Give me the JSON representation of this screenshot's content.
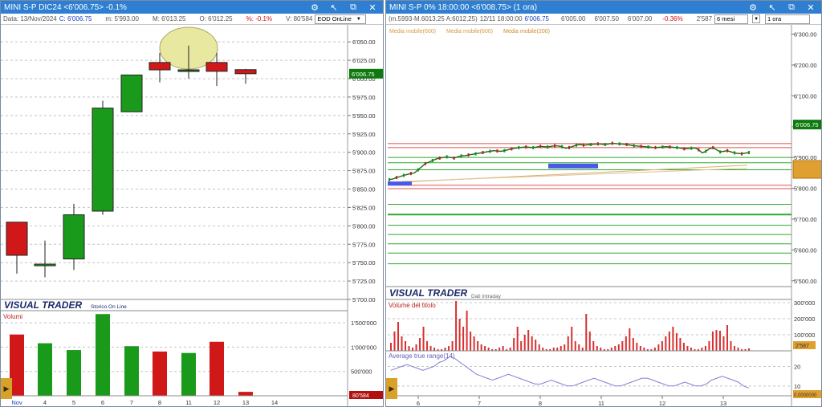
{
  "left_window": {
    "title": "MINI S-P DIC24 <6'006.75> -0.1%",
    "info": {
      "date": "Data: 13/Nov/2024",
      "close": "C: 6'006.75",
      "min": "m: 5'993.00",
      "max": "M: 6'013.25",
      "open": "O: 6'012.25",
      "pct": "%: -0.1%",
      "vol": "V: 80'584",
      "mode_select": "EOD OnLine"
    },
    "price_axis": [
      "6'050.00",
      "6'025.00",
      "6'000.00",
      "5'975.00",
      "5'950.00",
      "5'925.00",
      "5'900.00",
      "5'875.00",
      "5'850.00",
      "5'825.00",
      "5'800.00",
      "5'775.00",
      "5'750.00",
      "5'725.00",
      "5'700.00"
    ],
    "last_price_label": "6'006.75",
    "brand": "VISUAL TRADER",
    "brand_sub": "Storico On Line",
    "volume_title": "Volumi",
    "volume_axis": [
      "1'500'000",
      "1'000'000",
      "500'000"
    ],
    "last_volume_label": "80'584",
    "x_labels": [
      "Nov",
      "4",
      "5",
      "6",
      "7",
      "8",
      "11",
      "12",
      "13",
      "14"
    ],
    "colors": {
      "up": "#1a9a1a",
      "down": "#d01818",
      "highlight": "#e8e8a0"
    }
  },
  "right_window": {
    "title": "MINI S-P 0% 18:00:00 <6'008.75> (1 ora)",
    "info": {
      "range": "(m.5993-M.6013,25 A:6012,25)",
      "datetime": "12/11 18:00:00",
      "last": "6'006.75",
      "v1": "6'005.00",
      "v2": "6'007.50",
      "v3": "6'007.00",
      "pct": "-0.36%",
      "vol": "2'587",
      "period_select": "6 mesi",
      "interval_select": "1 ora"
    },
    "moving_averages": [
      "Media mobile(600)",
      "Media mobile(600)",
      "Media mobile(200)"
    ],
    "price_axis": [
      "6'300.00",
      "6'200.00",
      "6'100.00",
      "6'000.00",
      "5'900.00",
      "5'800.00",
      "5'700.00",
      "5'600.00",
      "5'500.00"
    ],
    "last_price_label": "6'006.75",
    "brand": "VISUAL TRADER",
    "brand_sub": "Dati Intraday",
    "volume_title": "Volume del titolo",
    "volume_axis": [
      "300'000",
      "200'000",
      "100'000"
    ],
    "last_volume_label": "2'587",
    "atr_title": "Average true range(14)",
    "atr_axis": [
      "20",
      "10"
    ],
    "last_atr_label": "0.0000000",
    "x_labels": [
      "6",
      "7",
      "8",
      "11",
      "12",
      "13"
    ]
  },
  "chart_data": [
    {
      "type": "candlestick",
      "title": "MINI S-P DIC24",
      "categories": [
        "Nov 1",
        "Nov 4",
        "Nov 5",
        "Nov 6",
        "Nov 7",
        "Nov 8",
        "Nov 11",
        "Nov 12",
        "Nov 13"
      ],
      "open": [
        5805,
        5748,
        5755,
        5820,
        5955,
        6022,
        6012,
        6022,
        6012.25
      ],
      "high": [
        5805,
        5780,
        5830,
        5970,
        6005,
        6035,
        6045,
        6035,
        6013.25
      ],
      "low": [
        5735,
        5730,
        5740,
        5815,
        5955,
        5995,
        6000,
        5990,
        5993
      ],
      "close": [
        5760,
        5748,
        5815,
        5960,
        6005,
        6012,
        6012,
        6010,
        6006.75
      ],
      "volume": [
        1260000,
        1080000,
        940000,
        1680000,
        1020000,
        910000,
        880000,
        1110000,
        80584
      ],
      "ylim": [
        5700,
        6060
      ]
    },
    {
      "type": "line",
      "title": "MINI S-P 1 ora",
      "ylim": [
        5450,
        6330
      ],
      "x_labels": [
        "6",
        "7",
        "8",
        "11",
        "12",
        "13"
      ],
      "series": [
        {
          "values": [
            5828,
            5830,
            5835,
            5838,
            5842,
            5845,
            5848,
            5850,
            5860,
            5870,
            5880,
            5885,
            5890,
            5895,
            5898,
            5900,
            5902,
            5900,
            5898,
            5902,
            5905,
            5906,
            5908,
            5910,
            5912,
            5914,
            5916,
            5918,
            5920,
            5922,
            5921,
            5920,
            5922,
            5925,
            5928,
            5930,
            5932,
            5933,
            5934,
            5933,
            5932,
            5934,
            5936,
            5935,
            5934,
            5936,
            5938,
            5937,
            5935,
            5930,
            5932,
            5936,
            5940,
            5942,
            5940,
            5941,
            5942,
            5943,
            5944,
            5943,
            5942,
            5944,
            5946,
            5945,
            5944,
            5943,
            5942,
            5940,
            5938,
            5937,
            5936,
            5935,
            5934,
            5933,
            5932,
            5933,
            5934,
            5935,
            5934,
            5933,
            5932,
            5930,
            5928,
            5929,
            5930,
            5931,
            5925,
            5915,
            5920,
            5928,
            5932,
            5925,
            5918,
            5920,
            5922,
            5918,
            5915,
            5913,
            5912,
            5914,
            5916
          ]
        }
      ]
    }
  ]
}
